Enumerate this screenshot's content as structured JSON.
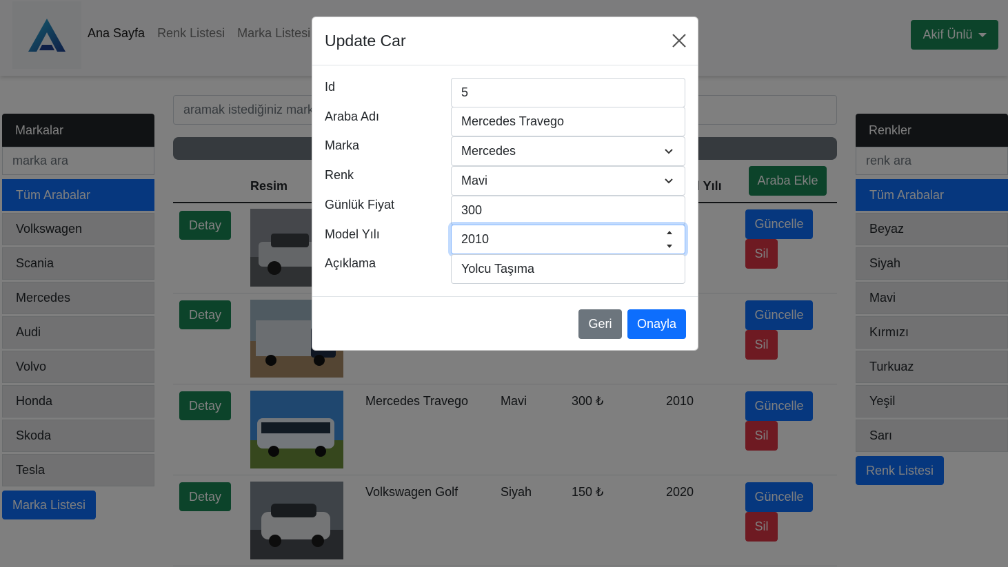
{
  "navbar": {
    "links": [
      "Ana Sayfa",
      "Renk Listesi",
      "Marka Listesi"
    ],
    "user_label": "Akif Ünlü"
  },
  "brands": {
    "title": "Markalar",
    "search_placeholder": "marka ara",
    "all_label": "Tüm Arabalar",
    "items": [
      "Volkswagen",
      "Scania",
      "Mercedes",
      "Audi",
      "Volvo",
      "Honda",
      "Skoda",
      "Tesla"
    ],
    "list_button": "Marka Listesi"
  },
  "colors": {
    "title": "Renkler",
    "search_placeholder": "renk ara",
    "all_label": "Tüm Arabalar",
    "items": [
      "Beyaz",
      "Siyah",
      "Mavi",
      "Kırmızı",
      "Turkuaz",
      "Yeşil",
      "Sarı"
    ],
    "list_button": "Renk Listesi"
  },
  "main": {
    "search_placeholder": "aramak istediğiniz mark",
    "headers": {
      "image": "Resim",
      "year": "l Yılı"
    },
    "add_button": "Araba Ekle",
    "detail_label": "Detay",
    "update_label": "Güncelle",
    "delete_label": "Sil",
    "rows": [
      {
        "name": "",
        "color": "",
        "price": "",
        "year": "",
        "img": "pickup"
      },
      {
        "name": "",
        "color": "",
        "price": "",
        "year": "",
        "img": "truck"
      },
      {
        "name": "Mercedes Travego",
        "color": "Mavi",
        "price": "300 ₺",
        "year": "2010",
        "img": "bus"
      },
      {
        "name": "Volkswagen Golf",
        "color": "Siyah",
        "price": "150 ₺",
        "year": "2020",
        "img": "golf"
      }
    ]
  },
  "modal": {
    "title": "Update Car",
    "fields": {
      "id_label": "Id",
      "id_value": "5",
      "name_label": "Araba Adı",
      "name_value": "Mercedes Travego",
      "brand_label": "Marka",
      "brand_value": "Mercedes",
      "color_label": "Renk",
      "color_value": "Mavi",
      "price_label": "Günlük Fiyat",
      "price_value": "300",
      "year_label": "Model Yılı",
      "year_value": "2010",
      "desc_label": "Açıklama",
      "desc_value": "Yolcu Taşıma"
    },
    "back_button": "Geri",
    "confirm_button": "Onayla"
  },
  "theme": {
    "primary": "#0d6efd",
    "success": "#198754",
    "danger": "#dc3545",
    "secondary": "#6c757d",
    "dark": "#212529"
  }
}
